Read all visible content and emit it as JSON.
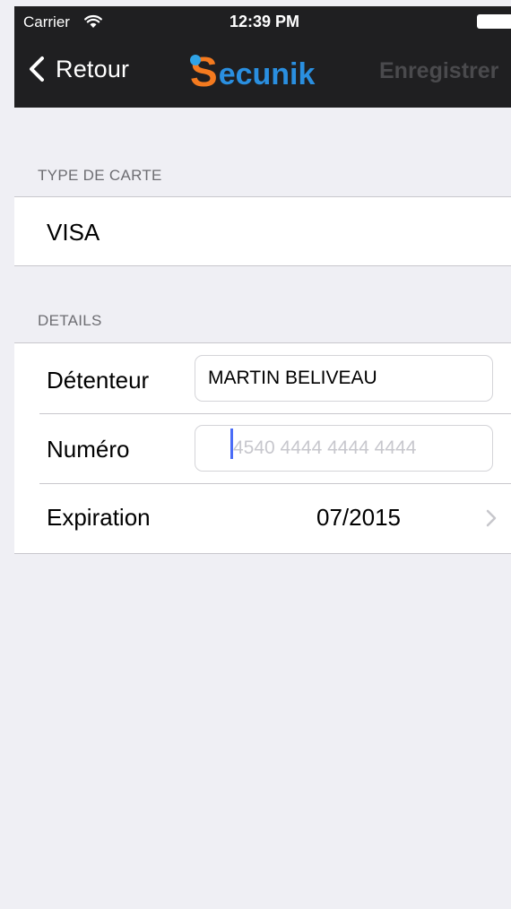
{
  "status_bar": {
    "carrier": "Carrier",
    "wifi_icon": "wifi-icon",
    "time": "12:39 PM",
    "battery_icon": "battery-icon"
  },
  "nav": {
    "back_label": "Retour",
    "back_icon": "chevron-left-icon",
    "logo_letter": "S",
    "logo_rest": "ecunik",
    "save_label": "Enregistrer"
  },
  "card_type_section": {
    "header": "TYPE DE CARTE",
    "value": "VISA"
  },
  "details_section": {
    "header": "DETAILS",
    "holder_label": "Détenteur",
    "holder_value": "MARTIN BELIVEAU",
    "number_label": "Numéro",
    "number_placeholder": "4540 4444 4444 4444",
    "expiration_label": "Expiration",
    "expiration_value": "07/2015",
    "chevron_icon": "chevron-right-icon"
  },
  "colors": {
    "nav_background": "#1f1f21",
    "logo_orange": "#f47a1f",
    "logo_blue": "#2a8fe0",
    "page_background": "#efeff4",
    "cursor": "#4a6cf7"
  }
}
